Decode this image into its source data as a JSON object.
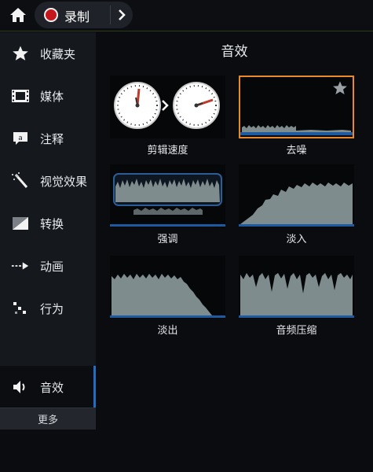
{
  "topbar": {
    "home_icon": "home-icon",
    "record_label": "录制",
    "chevron_icon": "chevron-right-icon"
  },
  "sidebar": {
    "items": [
      {
        "label": "收藏夹",
        "icon": "star-icon"
      },
      {
        "label": "媒体",
        "icon": "film-icon"
      },
      {
        "label": "注释",
        "icon": "annotation-icon"
      },
      {
        "label": "视觉效果",
        "icon": "magic-wand-icon"
      },
      {
        "label": "转换",
        "icon": "transition-icon"
      },
      {
        "label": "动画",
        "icon": "animation-arrow-icon"
      },
      {
        "label": "行为",
        "icon": "behavior-icon"
      },
      {
        "label": "音效",
        "icon": "speaker-icon",
        "active": true
      }
    ],
    "more_label": "更多"
  },
  "main": {
    "title": "音效",
    "tiles": [
      {
        "name": "剪辑速度"
      },
      {
        "name": "去噪",
        "selected": true
      },
      {
        "name": "强调"
      },
      {
        "name": "淡入"
      },
      {
        "name": "淡出"
      },
      {
        "name": "音频压缩"
      }
    ]
  },
  "colors": {
    "accent_blue": "#1e6fc2",
    "selected_orange": "#e8892a",
    "record_red": "#c4161c",
    "waveform": "#7f8c8d"
  }
}
